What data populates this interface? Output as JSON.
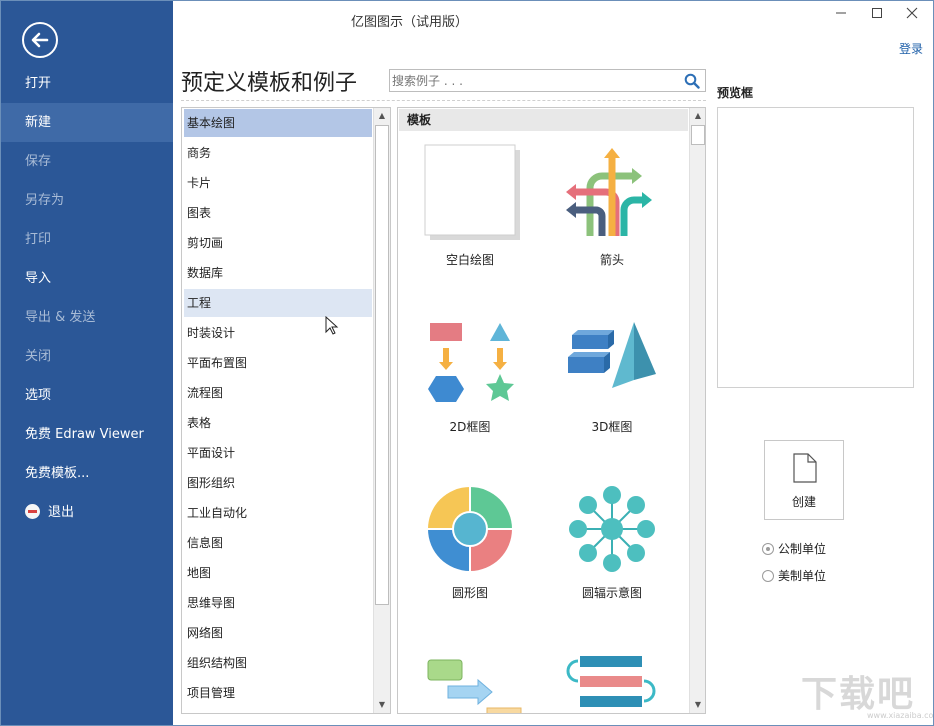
{
  "window": {
    "title": "亿图图示（试用版）",
    "login": "登录"
  },
  "sidebar": {
    "items": [
      {
        "label": "打开"
      },
      {
        "label": "新建"
      },
      {
        "label": "保存"
      },
      {
        "label": "另存为"
      },
      {
        "label": "打印"
      },
      {
        "label": "导入"
      },
      {
        "label": "导出 & 发送"
      },
      {
        "label": "关闭"
      },
      {
        "label": "选项"
      },
      {
        "label": "免费 Edraw Viewer"
      },
      {
        "label": "免费模板..."
      },
      {
        "label": "退出"
      }
    ]
  },
  "main": {
    "title": "预定义模板和例子",
    "search_placeholder": "搜索例子 . . .",
    "categories": [
      "基本绘图",
      "商务",
      "卡片",
      "图表",
      "剪切画",
      "数据库",
      "工程",
      "时装设计",
      "平面布置图",
      "流程图",
      "表格",
      "平面设计",
      "图形组织",
      "工业自动化",
      "信息图",
      "地图",
      "思维导图",
      "网络图",
      "组织结构图",
      "项目管理"
    ],
    "templates_header": "模板",
    "templates": [
      {
        "label": "空白绘图",
        "icon": "blank-page-icon"
      },
      {
        "label": "箭头",
        "icon": "arrows-icon"
      },
      {
        "label": "2D框图",
        "icon": "2d-block-icon"
      },
      {
        "label": "3D框图",
        "icon": "3d-block-icon"
      },
      {
        "label": "圆形图",
        "icon": "circle-diagram-icon"
      },
      {
        "label": "圆辐示意图",
        "icon": "spoke-diagram-icon"
      }
    ]
  },
  "preview": {
    "label": "预览框",
    "create_label": "创建",
    "units": [
      "公制单位",
      "美制单位"
    ],
    "selected_unit": "公制单位"
  },
  "watermark": {
    "text": "下载吧",
    "sub": "www.xiazaiba.com"
  },
  "colors": {
    "sidebar": "#2b5797",
    "sidebar_selected": "#3f6aa7",
    "category_selected": "#b3c6e6",
    "link": "#1e5fa8"
  }
}
